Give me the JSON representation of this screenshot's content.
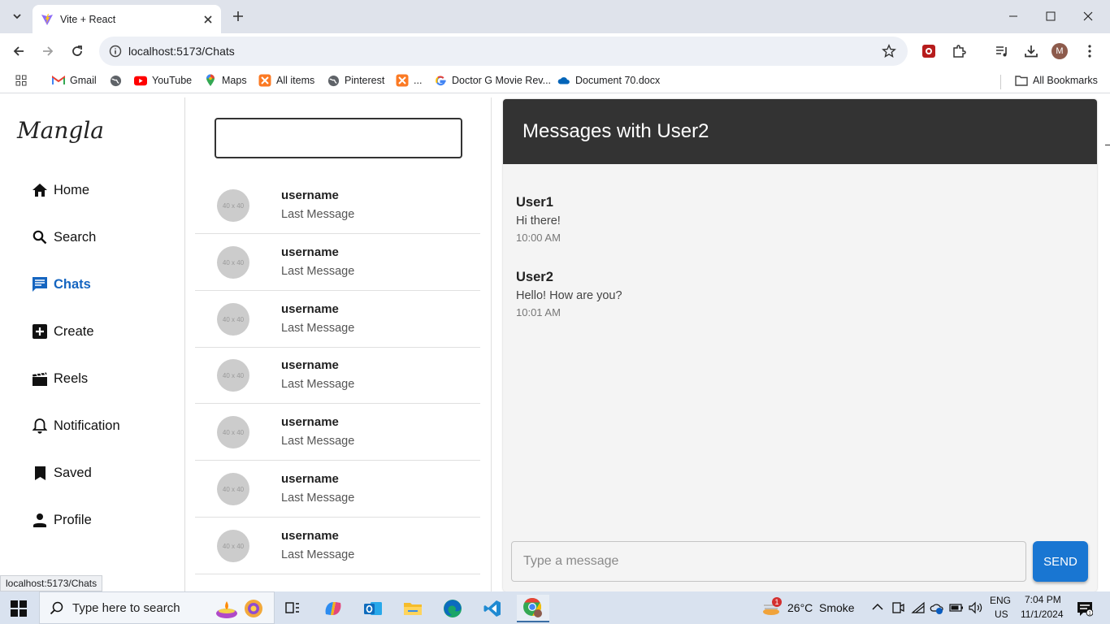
{
  "browser": {
    "tab_title": "Vite + React",
    "url": "localhost:5173/Chats",
    "status_url": "localhost:5173/Chats",
    "profile_initial": "M",
    "bookmarks": [
      "Gmail",
      "YouTube",
      "Maps",
      "All items",
      "Pinterest",
      "...",
      "Doctor G Movie Rev...",
      "Document 70.docx"
    ],
    "all_bookmarks": "All Bookmarks"
  },
  "app": {
    "logo": "Mangla",
    "nav": [
      {
        "label": "Home",
        "icon": "home-icon"
      },
      {
        "label": "Search",
        "icon": "search-icon"
      },
      {
        "label": "Chats",
        "icon": "chat-icon",
        "active": true
      },
      {
        "label": "Create",
        "icon": "add-box-icon"
      },
      {
        "label": "Reels",
        "icon": "movie-icon"
      },
      {
        "label": "Notification",
        "icon": "bell-icon"
      },
      {
        "label": "Saved",
        "icon": "bookmark-icon"
      },
      {
        "label": "Profile",
        "icon": "person-icon"
      }
    ],
    "search_value": "",
    "chats": [
      {
        "avatar": "40 x 40",
        "name": "username",
        "last": "Last Message"
      },
      {
        "avatar": "40 x 40",
        "name": "username",
        "last": "Last Message"
      },
      {
        "avatar": "40 x 40",
        "name": "username",
        "last": "Last Message"
      },
      {
        "avatar": "40 x 40",
        "name": "username",
        "last": "Last Message"
      },
      {
        "avatar": "40 x 40",
        "name": "username",
        "last": "Last Message"
      },
      {
        "avatar": "40 x 40",
        "name": "username",
        "last": "Last Message"
      },
      {
        "avatar": "40 x 40",
        "name": "username",
        "last": "Last Message"
      }
    ],
    "conversation": {
      "title": "Messages with User2",
      "messages": [
        {
          "sender": "User1",
          "text": "Hi there!",
          "time": "10:00 AM"
        },
        {
          "sender": "User2",
          "text": "Hello! How are you?",
          "time": "10:01 AM"
        }
      ],
      "input_placeholder": "Type a message",
      "send_label": "SEND"
    }
  },
  "taskbar": {
    "search_placeholder": "Type here to search",
    "weather_temp": "26°C",
    "weather_desc": "Smoke",
    "weather_badge": "1",
    "lang": "ENG",
    "region": "US",
    "time": "7:04 PM",
    "date": "11/1/2024"
  }
}
